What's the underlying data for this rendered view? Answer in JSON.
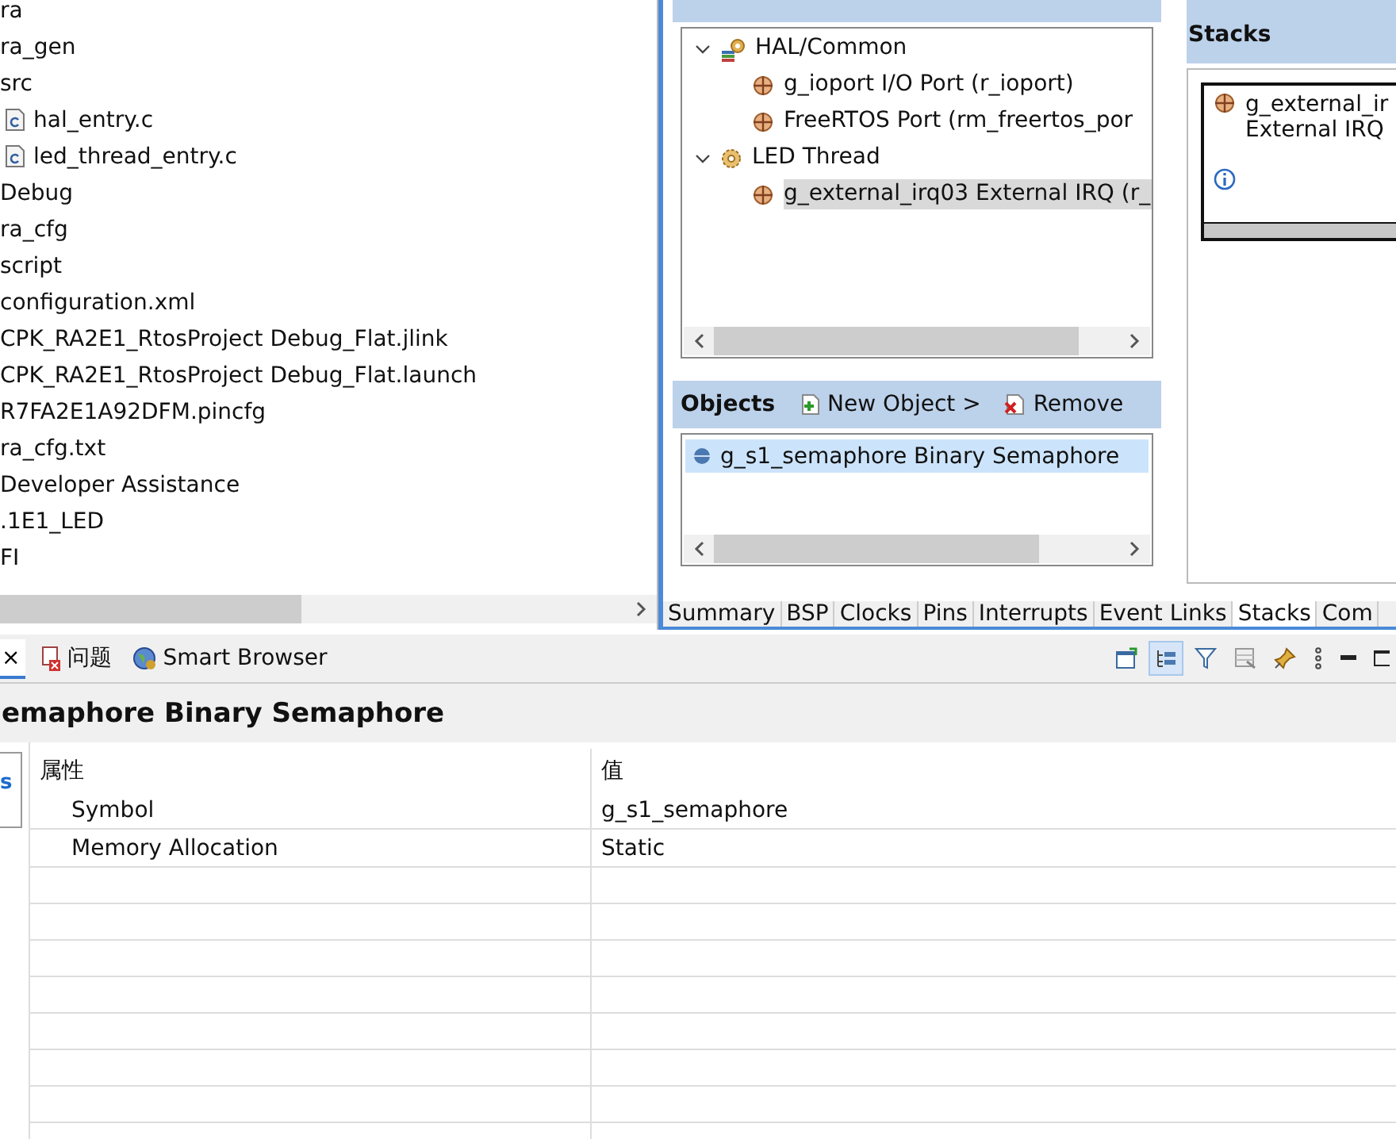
{
  "explorer": {
    "items": [
      {
        "label": "ra",
        "kind": "folder"
      },
      {
        "label": "ra_gen",
        "kind": "folder"
      },
      {
        "label": "src",
        "kind": "folder"
      },
      {
        "label": "hal_entry.c",
        "kind": "c-file"
      },
      {
        "label": "led_thread_entry.c",
        "kind": "c-file"
      },
      {
        "label": "Debug",
        "kind": "folder"
      },
      {
        "label": "ra_cfg",
        "kind": "folder"
      },
      {
        "label": "script",
        "kind": "folder"
      },
      {
        "label": "configuration.xml",
        "kind": "file"
      },
      {
        "label": "CPK_RA2E1_RtosProject Debug_Flat.jlink",
        "kind": "file"
      },
      {
        "label": "CPK_RA2E1_RtosProject Debug_Flat.launch",
        "kind": "file"
      },
      {
        "label": "R7FA2E1A92DFM.pincfg",
        "kind": "file"
      },
      {
        "label": "ra_cfg.txt",
        "kind": "file"
      },
      {
        "label": "Developer Assistance",
        "kind": "folder"
      },
      {
        "label": ".1E1_LED",
        "kind": "project"
      },
      {
        "label": "FI",
        "kind": "project"
      }
    ]
  },
  "threads": {
    "tree": [
      {
        "label": "HAL/Common",
        "kind": "group",
        "expanded": true,
        "selected": false,
        "children": [
          {
            "label": "g_ioport I/O Port (r_ioport)",
            "kind": "module",
            "selected": false
          },
          {
            "label": "FreeRTOS Port (rm_freertos_por",
            "kind": "module",
            "selected": false
          }
        ]
      },
      {
        "label": "LED Thread",
        "kind": "thread",
        "expanded": true,
        "selected": false,
        "children": [
          {
            "label": "g_external_irq03 External IRQ (r_",
            "kind": "module",
            "selected": true
          }
        ]
      }
    ]
  },
  "objects": {
    "title": "Objects",
    "actions": [
      {
        "label": "New Object >",
        "kind": "add"
      },
      {
        "label": "Remove",
        "kind": "remove"
      }
    ],
    "items": [
      {
        "label": "g_s1_semaphore Binary Semaphore",
        "selected": true
      }
    ]
  },
  "stacks": {
    "title": "Stacks",
    "card": {
      "name": "g_external_ir",
      "type": "External IRQ"
    }
  },
  "editor_tabs": [
    {
      "label": "Summary",
      "selected": false
    },
    {
      "label": "BSP",
      "selected": false
    },
    {
      "label": "Clocks",
      "selected": false
    },
    {
      "label": "Pins",
      "selected": false
    },
    {
      "label": "Interrupts",
      "selected": false
    },
    {
      "label": "Event Links",
      "selected": false
    },
    {
      "label": "Stacks",
      "selected": true
    },
    {
      "label": "Com",
      "selected": false
    }
  ],
  "bottom_tabs": {
    "close": "×",
    "tabs": [
      {
        "label": "问题",
        "kind": "problems"
      },
      {
        "label": "Smart Browser",
        "kind": "browser"
      }
    ]
  },
  "toolbar": [
    {
      "kind": "new",
      "selected": false
    },
    {
      "kind": "tree",
      "selected": true
    },
    {
      "kind": "filter",
      "selected": false
    },
    {
      "kind": "table",
      "selected": false
    },
    {
      "kind": "pin",
      "selected": false
    },
    {
      "kind": "more",
      "selected": false
    },
    {
      "kind": "minimize",
      "selected": false
    },
    {
      "kind": "maximize",
      "selected": false
    }
  ],
  "properties": {
    "title": "emaphore Binary Semaphore",
    "side_tab": "s",
    "columns": [
      "属性",
      "值"
    ],
    "rows": [
      {
        "property": "Symbol",
        "value": "g_s1_semaphore"
      },
      {
        "property": "Memory Allocation",
        "value": "Static"
      }
    ]
  }
}
